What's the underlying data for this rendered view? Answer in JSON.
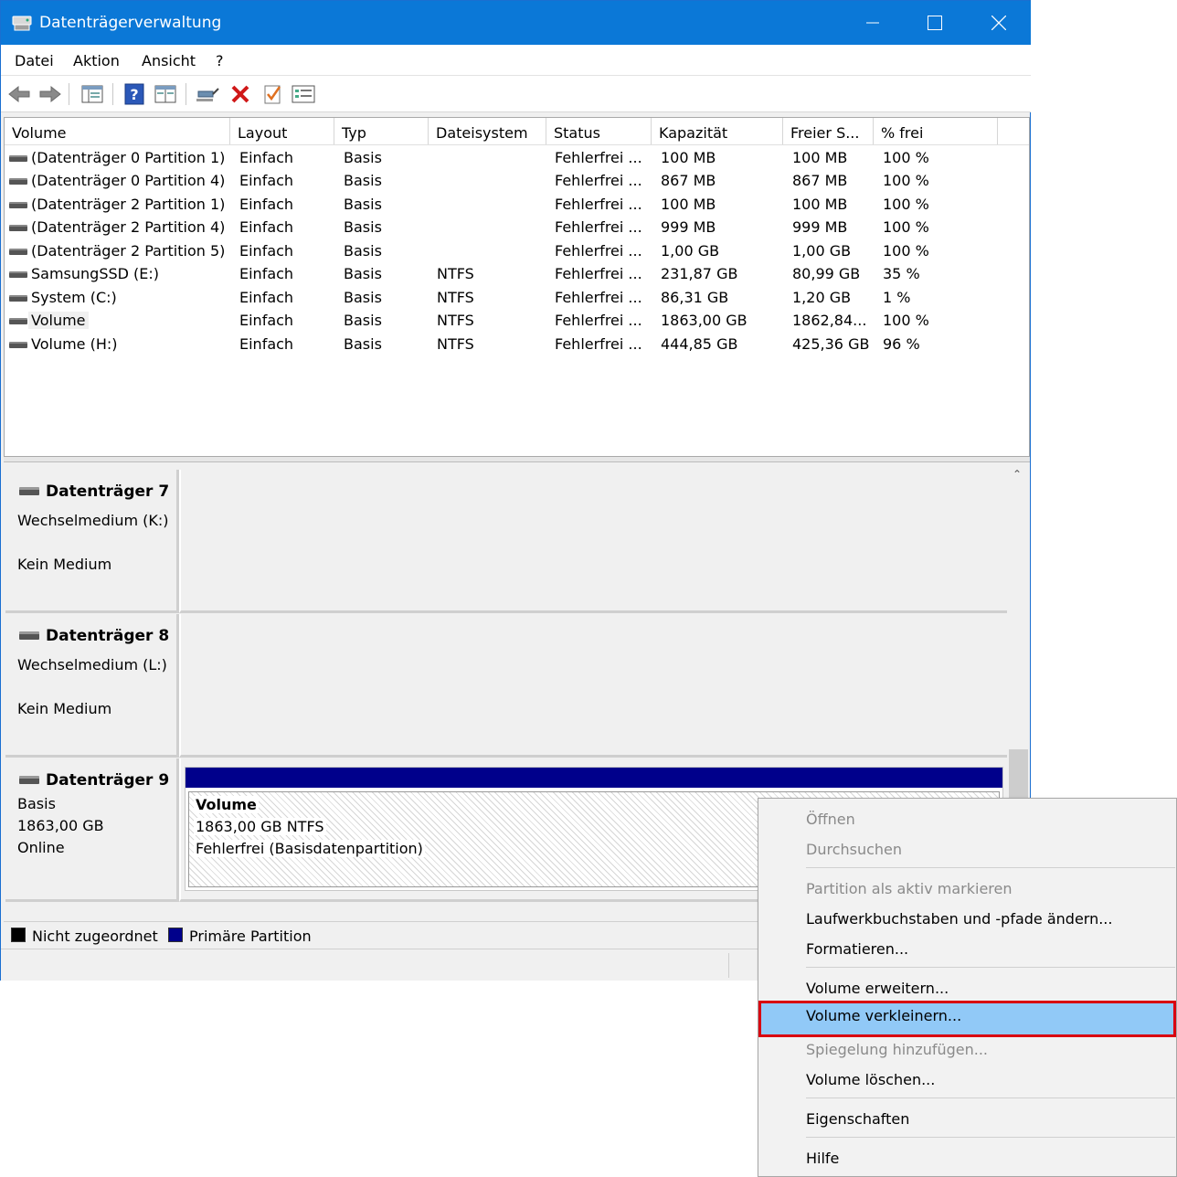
{
  "window": {
    "title": "Datenträgerverwaltung",
    "controls": {
      "minimize": "—",
      "maximize": "☐",
      "close": "✕"
    }
  },
  "menubar": [
    "Datei",
    "Aktion",
    "Ansicht",
    "?"
  ],
  "toolbar": {
    "icons": [
      "back-icon",
      "forward-icon",
      "console-tree-icon",
      "help-icon",
      "properties-icon",
      "connect-icon",
      "delete-icon",
      "check-icon",
      "list-icon"
    ]
  },
  "list": {
    "columns": [
      "Volume",
      "Layout",
      "Typ",
      "Dateisystem",
      "Status",
      "Kapazität",
      "Freier S...",
      "% frei"
    ],
    "rows": [
      {
        "volume": "(Datenträger 0 Partition 1)",
        "layout": "Einfach",
        "typ": "Basis",
        "fs": "",
        "status": "Fehlerfrei ...",
        "kap": "100 MB",
        "frei": "100 MB",
        "pct": "100 %"
      },
      {
        "volume": "(Datenträger 0 Partition 4)",
        "layout": "Einfach",
        "typ": "Basis",
        "fs": "",
        "status": "Fehlerfrei ...",
        "kap": "867 MB",
        "frei": "867 MB",
        "pct": "100 %"
      },
      {
        "volume": "(Datenträger 2 Partition 1)",
        "layout": "Einfach",
        "typ": "Basis",
        "fs": "",
        "status": "Fehlerfrei ...",
        "kap": "100 MB",
        "frei": "100 MB",
        "pct": "100 %"
      },
      {
        "volume": "(Datenträger 2 Partition 4)",
        "layout": "Einfach",
        "typ": "Basis",
        "fs": "",
        "status": "Fehlerfrei ...",
        "kap": "999 MB",
        "frei": "999 MB",
        "pct": "100 %"
      },
      {
        "volume": "(Datenträger 2 Partition 5)",
        "layout": "Einfach",
        "typ": "Basis",
        "fs": "",
        "status": "Fehlerfrei ...",
        "kap": "1,00 GB",
        "frei": "1,00 GB",
        "pct": "100 %"
      },
      {
        "volume": "SamsungSSD (E:)",
        "layout": "Einfach",
        "typ": "Basis",
        "fs": "NTFS",
        "status": "Fehlerfrei ...",
        "kap": "231,87 GB",
        "frei": "80,99 GB",
        "pct": "35 %"
      },
      {
        "volume": "System (C:)",
        "layout": "Einfach",
        "typ": "Basis",
        "fs": "NTFS",
        "status": "Fehlerfrei ...",
        "kap": "86,31 GB",
        "frei": "1,20 GB",
        "pct": "1 %"
      },
      {
        "volume": "Volume",
        "layout": "Einfach",
        "typ": "Basis",
        "fs": "NTFS",
        "status": "Fehlerfrei ...",
        "kap": "1863,00 GB",
        "frei": "1862,84...",
        "pct": "100 %"
      },
      {
        "volume": "Volume (H:)",
        "layout": "Einfach",
        "typ": "Basis",
        "fs": "NTFS",
        "status": "Fehlerfrei ...",
        "kap": "444,85 GB",
        "frei": "425,36 GB",
        "pct": "96 %"
      }
    ]
  },
  "disks": [
    {
      "name": "Datenträger 7",
      "line1": "Wechselmedium (K:)",
      "line2": "Kein Medium"
    },
    {
      "name": "Datenträger 8",
      "line1": "Wechselmedium (L:)",
      "line2": "Kein Medium"
    },
    {
      "name": "Datenträger 9",
      "line1": "Basis",
      "line2": "1863,00 GB",
      "line3": "Online",
      "partition": {
        "name": "Volume",
        "size": "1863,00 GB NTFS",
        "status": "Fehlerfrei (Basisdatenpartition)"
      }
    }
  ],
  "legend": [
    {
      "label": "Nicht zugeordnet",
      "color": "#000000"
    },
    {
      "label": "Primäre Partition",
      "color": "#00008b"
    }
  ],
  "context_menu": {
    "items": [
      {
        "label": "Öffnen",
        "disabled": true
      },
      {
        "label": "Durchsuchen",
        "disabled": true
      },
      {
        "label": "Partition als aktiv markieren",
        "disabled": true
      },
      {
        "label": "Laufwerkbuchstaben und -pfade ändern...",
        "disabled": false
      },
      {
        "label": "Formatieren...",
        "disabled": false
      },
      {
        "label": "Volume erweitern...",
        "disabled": false
      },
      {
        "label": "Volume verkleinern...",
        "disabled": false,
        "highlighted": true
      },
      {
        "label": "Spiegelung hinzufügen...",
        "disabled": true
      },
      {
        "label": "Volume löschen...",
        "disabled": false
      },
      {
        "label": "Eigenschaften",
        "disabled": false
      },
      {
        "label": "Hilfe",
        "disabled": false
      }
    ]
  },
  "colors": {
    "titlebar": "#0b78d7",
    "partition_bar": "#00008b",
    "highlight": "#91c9f7",
    "highlight_border": "#d90010"
  }
}
